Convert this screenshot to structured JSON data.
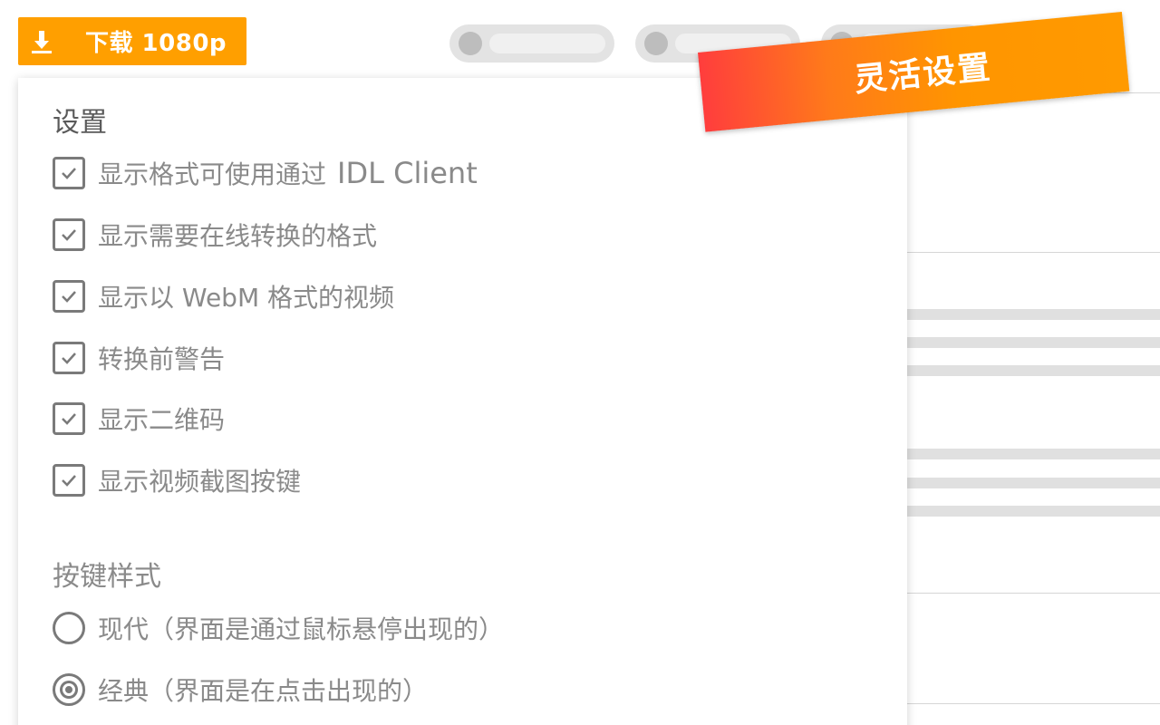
{
  "toolbar": {
    "download_label": "下载 1080p"
  },
  "ribbon": {
    "text": "灵活设置"
  },
  "settings": {
    "title": "设置",
    "options": [
      {
        "label": "显示格式可使用通过",
        "suffix": "IDL Client",
        "checked": true
      },
      {
        "label": "显示需要在线转换的格式",
        "checked": true
      },
      {
        "label": "显示以 WebM 格式的视频",
        "checked": true
      },
      {
        "label": "转换前警告",
        "checked": true
      },
      {
        "label": "显示二维码",
        "checked": true
      },
      {
        "label": "显示视频截图按键",
        "checked": true
      }
    ],
    "button_style": {
      "title": "按键样式",
      "choices": [
        {
          "label": "现代（界面是通过鼠标悬停出现的）",
          "selected": false
        },
        {
          "label": "经典（界面是在点击出现的）",
          "selected": true
        }
      ]
    }
  },
  "colors": {
    "accent": "#ff9f00",
    "ribbon_start": "#ff3d3d",
    "ribbon_end": "#ff9a00",
    "control_gray": "#7a7a7a",
    "text_gray": "#8a8a8a"
  }
}
